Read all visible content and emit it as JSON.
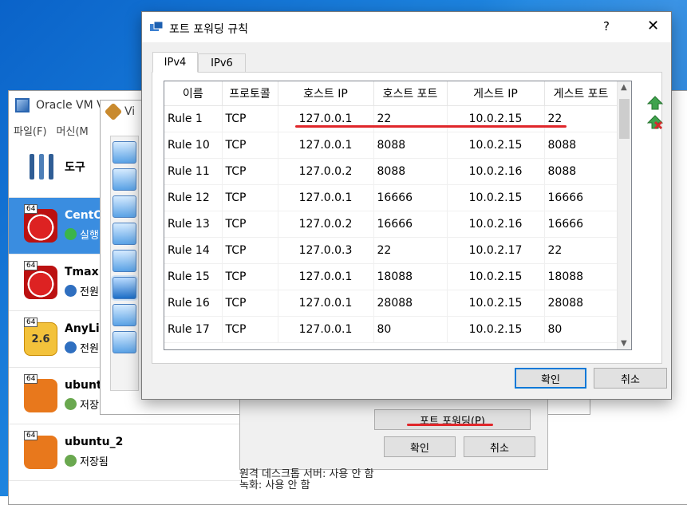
{
  "manager": {
    "title": "Oracle VM V",
    "menu": [
      "파일(F)",
      "머신(M"
    ],
    "tools_label": "도구",
    "vms": [
      {
        "name": "CentO",
        "state": "실행",
        "badge": "64",
        "os": "redhat",
        "state_icon": "running-arrow-icon",
        "selected": true
      },
      {
        "name": "Tmax",
        "state": "전원",
        "badge": "64",
        "os": "redhat",
        "state_icon": "power-off-icon"
      },
      {
        "name": "AnyLin",
        "state": "전원",
        "badge": "64",
        "os": "anylinux",
        "os_text": "2.6",
        "state_icon": "power-off-icon"
      },
      {
        "name": "ubuntu",
        "state": "저장",
        "badge": "64",
        "os": "ubuntu",
        "state_icon": "saved-state-icon"
      },
      {
        "name": "ubuntu_2",
        "state": "저장됨",
        "badge": "64",
        "os": "ubuntu",
        "state_icon": "saved-state-icon"
      }
    ]
  },
  "settings": {
    "title": "Vi"
  },
  "network_dialog": {
    "port_forwarding_button": "포트 포워딩(P)",
    "ok_button": "확인",
    "cancel_button": "취소"
  },
  "details": {
    "rows": [
      {
        "label": "원격 데스크톱 서버:",
        "value": "사용 안 함"
      },
      {
        "label": "녹화:",
        "value": "사용 안 함"
      }
    ]
  },
  "port_forwarding": {
    "title": "포트 포워딩 규칙",
    "help": "?",
    "close": "✕",
    "tabs": [
      {
        "label": "IPv4",
        "active": true
      },
      {
        "label": "IPv6",
        "active": false
      }
    ],
    "columns": [
      "이름",
      "프로토콜",
      "호스트 IP",
      "호스트 포트",
      "게스트 IP",
      "게스트 포트"
    ],
    "rows": [
      [
        "Rule 1",
        "TCP",
        "127.0.0.1",
        "22",
        "10.0.2.15",
        "22"
      ],
      [
        "Rule 10",
        "TCP",
        "127.0.0.1",
        "8088",
        "10.0.2.15",
        "8088"
      ],
      [
        "Rule 11",
        "TCP",
        "127.0.0.2",
        "8088",
        "10.0.2.16",
        "8088"
      ],
      [
        "Rule 12",
        "TCP",
        "127.0.0.1",
        "16666",
        "10.0.2.15",
        "16666"
      ],
      [
        "Rule 13",
        "TCP",
        "127.0.0.2",
        "16666",
        "10.0.2.16",
        "16666"
      ],
      [
        "Rule 14",
        "TCP",
        "127.0.0.3",
        "22",
        "10.0.2.17",
        "22"
      ],
      [
        "Rule 15",
        "TCP",
        "127.0.0.1",
        "18088",
        "10.0.2.15",
        "18088"
      ],
      [
        "Rule 16",
        "TCP",
        "127.0.0.1",
        "28088",
        "10.0.2.15",
        "28088"
      ],
      [
        "Rule 17",
        "TCP",
        "127.0.0.1",
        "80",
        "10.0.2.15",
        "80"
      ]
    ],
    "ok_button": "확인",
    "cancel_button": "취소",
    "icons": [
      "add-rule-icon",
      "remove-rule-icon"
    ]
  },
  "colors": {
    "accent": "#0078d7",
    "selection": "#3a8de0",
    "annotation": "#e0262a"
  }
}
